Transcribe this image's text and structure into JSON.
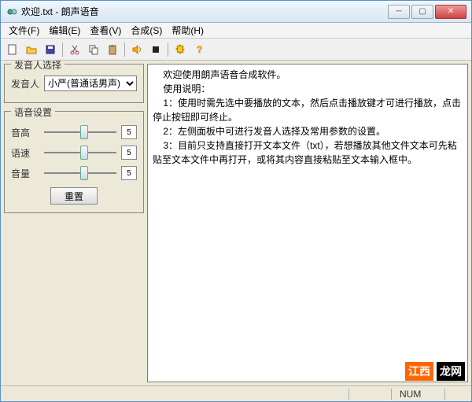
{
  "window": {
    "title": "欢迎.txt - 朗声语音"
  },
  "menu": {
    "file": "文件(F)",
    "edit": "编辑(E)",
    "view": "查看(V)",
    "synth": "合成(S)",
    "help": "帮助(H)"
  },
  "toolbar_icons": {
    "new": "new-file-icon",
    "open": "open-folder-icon",
    "save": "save-icon",
    "cut": "cut-icon",
    "copy": "copy-icon",
    "paste": "paste-icon",
    "speak": "speak-icon",
    "stop": "stop-icon",
    "settings": "settings-icon",
    "help": "help-icon"
  },
  "left": {
    "voice_group": "发音人选择",
    "voice_label": "发音人",
    "voice_selected": "小严(普通话男声)",
    "voice_options": [
      "小严(普通话男声)"
    ],
    "setting_group": "语音设置",
    "pitch_label": "音高",
    "speed_label": "语速",
    "volume_label": "音量",
    "pitch_value": "5",
    "speed_value": "5",
    "volume_value": "5",
    "reset": "重置"
  },
  "text_content": "    欢迎使用朗声语音合成软件。\n    使用说明：\n    1：使用时需先选中要播放的文本，然后点击播放键才可进行播放，点击停止按钮即可终止。\n    2：左侧面板中可进行发音人选择及常用参数的设置。\n    3：目前只支持直接打开文本文件（txt），若想播放其他文件文本可先粘贴至文本文件中再打开，或将其内容直接粘贴至文本输入框中。",
  "status": {
    "num": "NUM"
  },
  "watermark": {
    "a": "江西",
    "b": "龙网"
  },
  "colors": {
    "panel_bg": "#ece9d8",
    "border": "#7a7a7a",
    "titlebar_start": "#f0f6fc",
    "titlebar_end": "#d7e6f5"
  }
}
